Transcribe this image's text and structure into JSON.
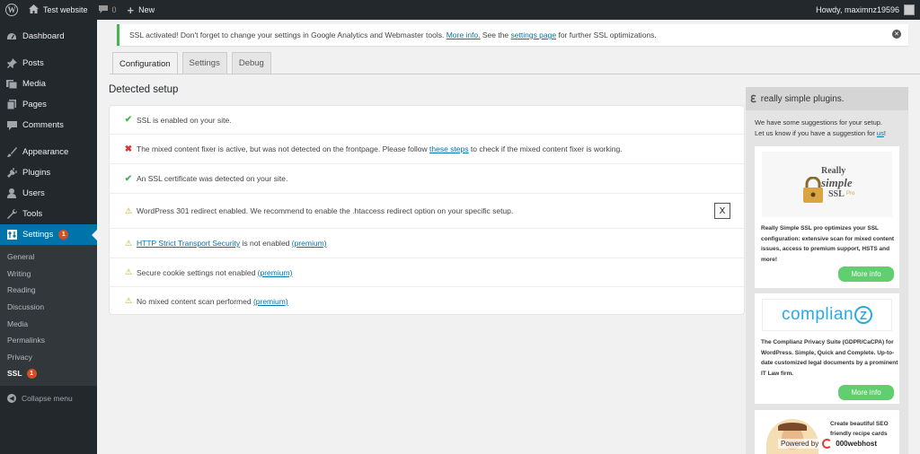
{
  "adminbar": {
    "site_name": "Test website",
    "comments_count": "0",
    "new_label": "New",
    "howdy": "Howdy, maximnz19596"
  },
  "sidebar": {
    "dashboard": "Dashboard",
    "posts": "Posts",
    "media": "Media",
    "pages": "Pages",
    "comments": "Comments",
    "appearance": "Appearance",
    "plugins": "Plugins",
    "users": "Users",
    "tools": "Tools",
    "settings": "Settings",
    "settings_badge": "1",
    "submenu": [
      "General",
      "Writing",
      "Reading",
      "Discussion",
      "Media",
      "Permalinks",
      "Privacy"
    ],
    "ssl": "SSL",
    "ssl_badge": "1",
    "collapse": "Collapse menu"
  },
  "notice": {
    "text_before": "SSL activated!  Don't forget to change your settings in Google Analytics and Webmaster tools.",
    "more_info": "More info.",
    "see_the": " See the ",
    "settings_page": "settings page",
    "text_after": " for further SSL optimizations."
  },
  "tabs": [
    "Configuration",
    "Settings",
    "Debug"
  ],
  "setup": {
    "title": "Detected setup",
    "rows": [
      {
        "text": "SSL is enabled on your site."
      },
      {
        "text": "The mixed content fixer is active, but was not detected on the frontpage. Please follow ",
        "link": "these steps",
        "after": " to check if the mixed content fixer is working."
      },
      {
        "text": "An SSL certificate was detected on your site."
      },
      {
        "text": "WordPress 301 redirect enabled. We recommend to enable the .htaccess redirect option on your specific setup.",
        "button": "X"
      },
      {
        "link": "HTTP Strict Transport Security",
        "after": " is not enabled ",
        "premium": "(premium)"
      },
      {
        "text": "Secure cookie settings not enabled ",
        "premium": "(premium)"
      },
      {
        "text": "No mixed content scan performed ",
        "premium": "(premium)"
      }
    ]
  },
  "promo": {
    "title": "really simple plugins.",
    "intro": "We have some suggestions for your setup.",
    "intro2": "Let us know if you have a suggestion for ",
    "intro_link": "us",
    "intro_end": "!",
    "card1_logo1": "Really",
    "card1_logo2": "simple",
    "card1_logo3": "SSL",
    "card1_logo4": "Pro",
    "card1_desc": "Really Simple SSL pro optimizes your SSL configuration: extensive scan for mixed content issues, access to premium support, HSTS and more!",
    "card2_logo": "complian",
    "card2_logo_z": "Z",
    "card2_desc": "The Complianz Privacy Suite (GDPR/CaCPA) for WordPress. Simple, Quick and Complete. Up-to-date customized legal documents by a prominent IT Law firm.",
    "card3_desc": "Create beautiful SEO friendly recipe cards",
    "more_info": "More info"
  },
  "powered": {
    "label": "Powered by",
    "brand": "000webhost"
  }
}
